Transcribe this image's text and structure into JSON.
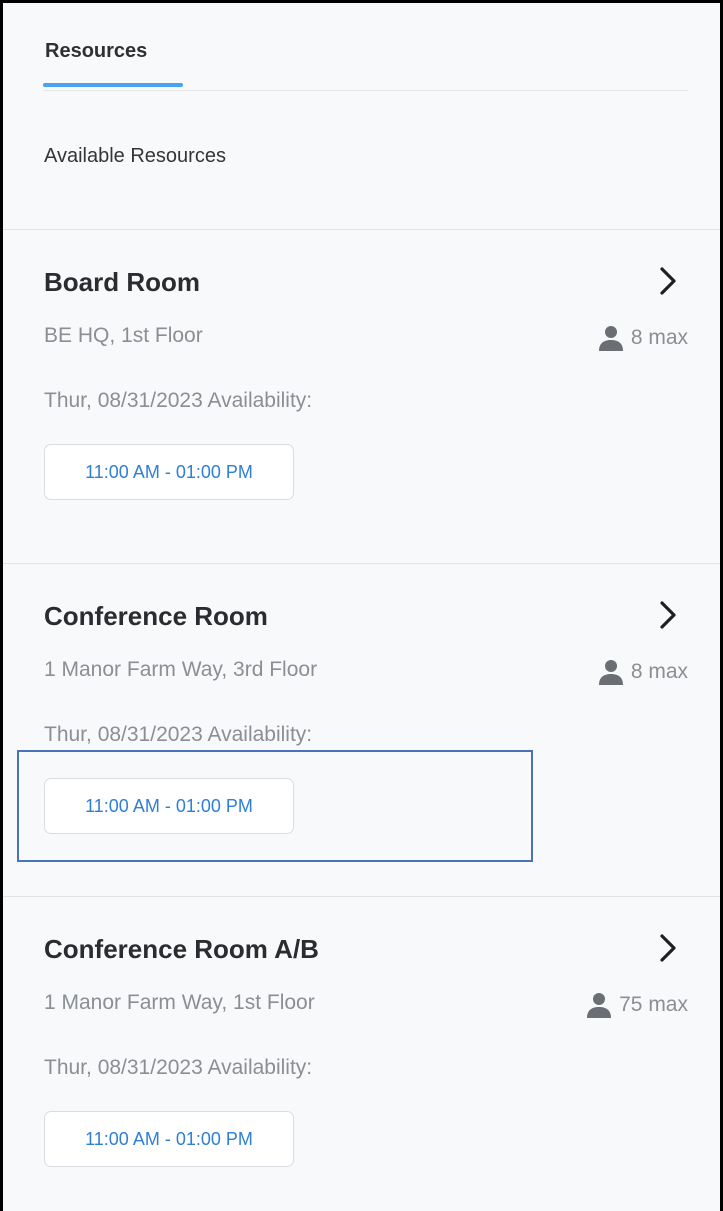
{
  "tabs": [
    {
      "label": "Resources",
      "active": true
    }
  ],
  "section_heading": "Available Resources",
  "resources": [
    {
      "name": "Board Room",
      "location": "BE HQ, 1st Floor",
      "capacity": "8 max",
      "availability_label": "Thur, 08/31/2023 Availability:",
      "time_slot": "11:00 AM - 01:00 PM"
    },
    {
      "name": "Conference Room",
      "location": "1 Manor Farm Way, 3rd Floor",
      "capacity": "8 max",
      "availability_label": "Thur, 08/31/2023 Availability:",
      "time_slot": "11:00 AM - 01:00 PM"
    },
    {
      "name": "Conference Room A/B",
      "location": "1 Manor Farm Way, 1st Floor",
      "capacity": "75 max",
      "availability_label": "Thur, 08/31/2023 Availability:",
      "time_slot": "11:00 AM - 01:00 PM"
    }
  ],
  "icons": {
    "card_action": "chevron-right-icon",
    "capacity": "person-icon"
  },
  "colors": {
    "accent": "#4aa3f0",
    "slot_text": "#2f7fd6",
    "highlight": "#4a72b8"
  }
}
